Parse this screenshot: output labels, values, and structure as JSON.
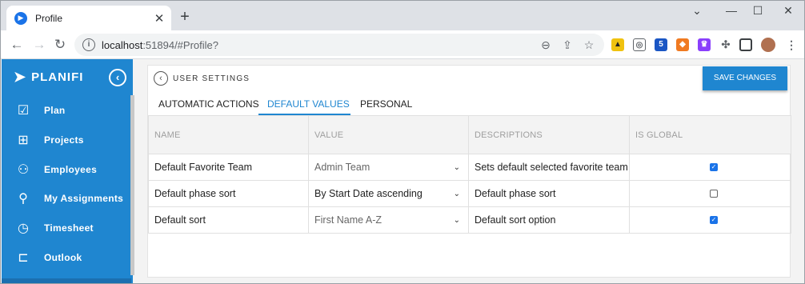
{
  "browser": {
    "tab_title": "Profile",
    "url_host": "localhost",
    "url_rest": ":51894/#Profile?",
    "extension_badge": "5"
  },
  "sidebar": {
    "brand": "PLANIFI",
    "items": [
      {
        "label": "Plan",
        "icon": "calendar-check-icon"
      },
      {
        "label": "Projects",
        "icon": "org-chart-icon"
      },
      {
        "label": "Employees",
        "icon": "people-icon"
      },
      {
        "label": "My Assignments",
        "icon": "person-icon"
      },
      {
        "label": "Timesheet",
        "icon": "clock-icon"
      },
      {
        "label": "Outlook",
        "icon": "door-icon"
      }
    ]
  },
  "header": {
    "breadcrumb": "USER SETTINGS",
    "save_label": "SAVE CHANGES"
  },
  "tabs": [
    "AUTOMATIC ACTIONS",
    "DEFAULT VALUES",
    "PERSONAL"
  ],
  "active_tab": "DEFAULT VALUES",
  "table": {
    "headers": [
      "NAME",
      "VALUE",
      "DESCRIPTIONS",
      "IS GLOBAL"
    ],
    "rows": [
      {
        "name": "Default Favorite Team",
        "value": "Admin Team",
        "description": "Sets default selected favorite team",
        "global": true
      },
      {
        "name": "Default phase sort",
        "value": "By Start Date ascending",
        "description": "Default phase sort",
        "global": false
      },
      {
        "name": "Default sort",
        "value": "First Name A-Z",
        "description": "Default sort option",
        "global": true
      }
    ]
  },
  "colors": {
    "accent": "#1f86d0",
    "checkbox": "#1a73e8"
  }
}
